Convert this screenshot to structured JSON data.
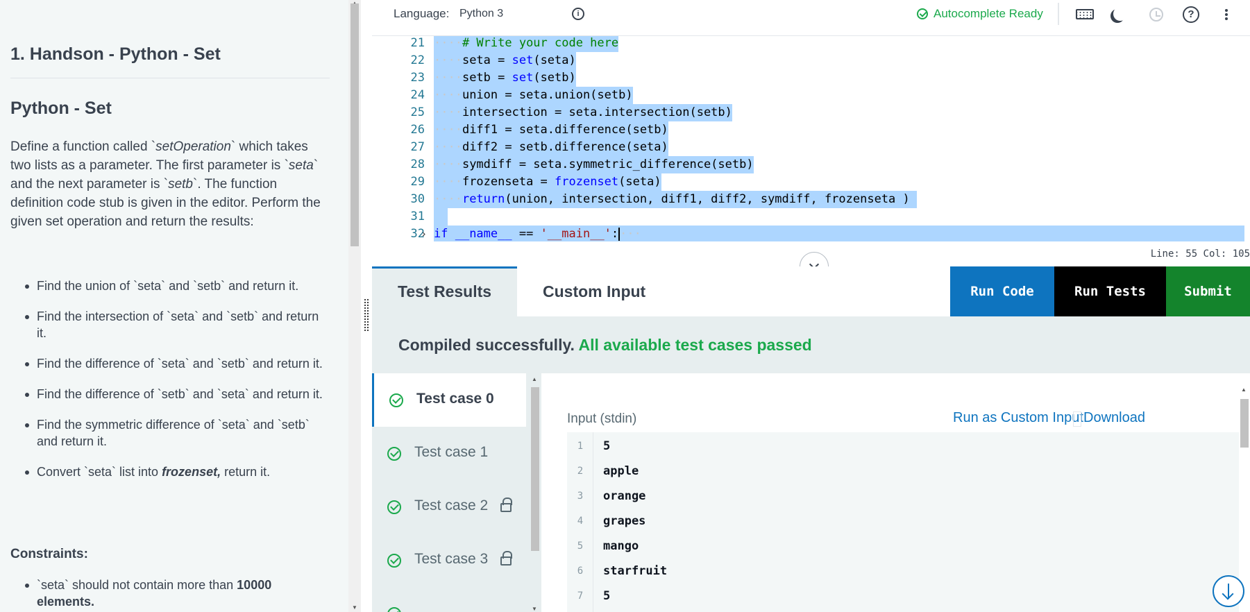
{
  "problem": {
    "title": "1. Handson - Python - Set",
    "subtitle": "Python - Set",
    "desc_1": "Define a function called `",
    "desc_fn": "setOperation",
    "desc_2": "` which takes two lists as a parameter. The first parameter is `",
    "desc_seta": "seta",
    "desc_3": "` and the next parameter is `",
    "desc_setb": "setb",
    "desc_4": "`. The function definition code stub is given in the editor. Perform the given set operation and return the results:",
    "bullets": [
      "Find the union of `seta` and `setb` and return it.",
      "Find the intersection of `seta` and `setb` and return it.",
      "Find the difference of `seta` and `setb` and return it.",
      "Find the difference of `setb` and `seta` and return it.",
      "Find the symmetric difference of `seta` and `setb` and return it."
    ],
    "bullet_last_pre": "Convert `seta` list into ",
    "bullet_last_bold": "frozenset,",
    "bullet_last_post": " return it.",
    "constraints_heading": "Constraints:",
    "constraint_pre": "`seta` should not contain more than ",
    "constraint_bold": "10000 elements."
  },
  "toolbar": {
    "language_label": "Language:",
    "language_value": "Python 3",
    "autocomplete": "Autocomplete Ready",
    "icons": [
      "info-icon",
      "check-circle-icon",
      "keyboard-icon",
      "moon-icon",
      "history-icon",
      "help-icon",
      "more-vertical-icon"
    ]
  },
  "editor": {
    "line_numbers": [
      "21",
      "22",
      "23",
      "24",
      "25",
      "26",
      "27",
      "28",
      "29",
      "30",
      "31",
      "32"
    ],
    "dots4": "····",
    "l21": "# Write your code here",
    "l22a": "seta = ",
    "l22b": "set",
    "l22c": "(seta)",
    "l23a": "setb = ",
    "l23b": "set",
    "l23c": "(setb)",
    "l24": "union = seta.union(setb)",
    "l25": "intersection = seta.intersection(setb)",
    "l26": "diff1 = seta.difference(setb)",
    "l27": "diff2 = setb.difference(seta)",
    "l28": "symdiff = seta.symmetric_difference(setb)",
    "l29a": "frozenseta = ",
    "l29b": "frozenset",
    "l29c": "(seta)",
    "l30a": "return",
    "l30b": "(union, intersection, diff1, diff2, symdiff, frozenseta )",
    "l32a": "if",
    "l32b": " __name__ ",
    "l32c": "==",
    "l32d": " '__main__'",
    "l32e": ":",
    "l32f": "···",
    "fold_glyph": "›",
    "status": "Line: 55 Col: 105"
  },
  "tabs": {
    "results": "Test Results",
    "custom": "Custom Input"
  },
  "actions": {
    "run_code": "Run Code",
    "run_tests": "Run Tests",
    "submit": "Submit"
  },
  "results": {
    "compiled": "Compiled successfully.",
    "passed": "All available test cases passed",
    "cases": [
      {
        "label": "Test case 0",
        "locked": false
      },
      {
        "label": "Test case 1",
        "locked": false
      },
      {
        "label": "Test case 2",
        "locked": true
      },
      {
        "label": "Test case 3",
        "locked": true
      }
    ],
    "input_label": "Input (stdin)",
    "run_as_custom": "Run as Custom Input",
    "download": "Download",
    "input_lines": [
      {
        "n": "1",
        "v": "5"
      },
      {
        "n": "2",
        "v": "apple"
      },
      {
        "n": "3",
        "v": "orange"
      },
      {
        "n": "4",
        "v": "grapes"
      },
      {
        "n": "5",
        "v": "mango"
      },
      {
        "n": "6",
        "v": "starfruit"
      },
      {
        "n": "7",
        "v": "5"
      }
    ]
  },
  "colors": {
    "accent_blue": "#0e74bf",
    "success_green": "#1ba94c",
    "submit_green": "#14842c",
    "selection": "#add6ff"
  }
}
